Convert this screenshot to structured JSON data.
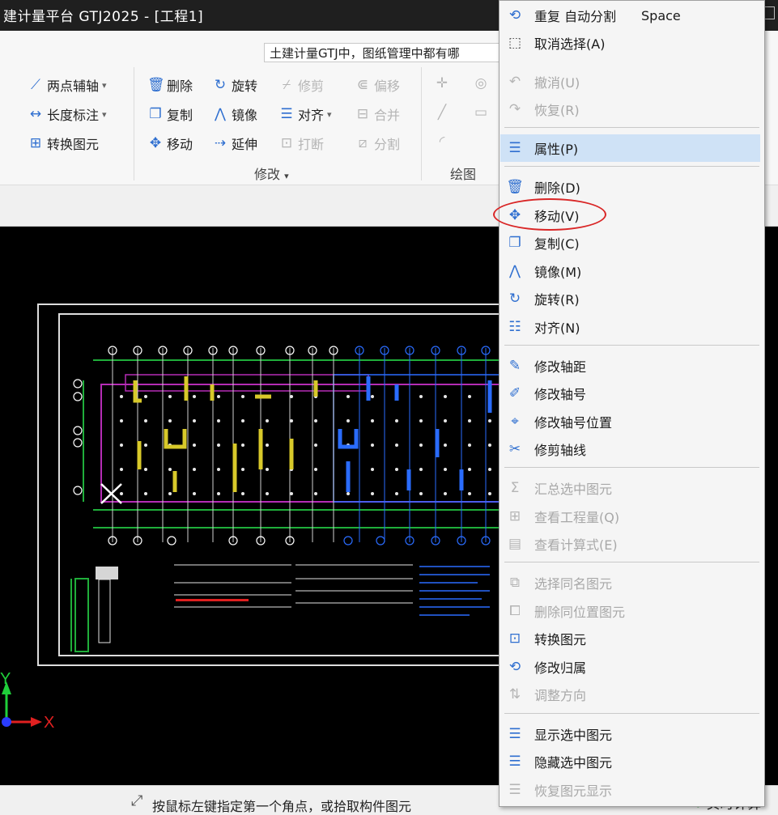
{
  "window": {
    "title": "建计量平台 GTJ2025 - [工程1]"
  },
  "search": {
    "text": "土建计量GTJ中，图纸管理中都有哪"
  },
  "ribbon": {
    "axis": {
      "two_point": "两点辅轴",
      "dim": "长度标注",
      "convert": "转换图元"
    },
    "modify": {
      "delete": "删除",
      "rotate": "旋转",
      "trim": "修剪",
      "offset": "偏移",
      "copy": "复制",
      "mirror": "镜像",
      "align": "对齐",
      "merge": "合并",
      "move": "移动",
      "extend": "延伸",
      "break": "打断",
      "split": "分割",
      "group_label": "修改"
    },
    "draw": {
      "group_label": "绘图"
    }
  },
  "context_menu": {
    "items": [
      {
        "label": "重复 自动分割",
        "shortcut": "Space",
        "icon": "repeat-icon",
        "enabled": true
      },
      {
        "label": "取消选择(A)",
        "icon": "deselect-icon",
        "enabled": true
      },
      {
        "label": "撤消(U)",
        "icon": "undo-icon",
        "enabled": false
      },
      {
        "label": "恢复(R)",
        "icon": "redo-icon",
        "enabled": false
      },
      {
        "label": "属性(P)",
        "icon": "properties-icon",
        "enabled": true,
        "highlighted": true
      },
      {
        "label": "删除(D)",
        "icon": "delete-icon",
        "enabled": true
      },
      {
        "label": "移动(V)",
        "icon": "move-icon",
        "enabled": true
      },
      {
        "label": "复制(C)",
        "icon": "copy-icon",
        "enabled": true
      },
      {
        "label": "镜像(M)",
        "icon": "mirror-icon",
        "enabled": true
      },
      {
        "label": "旋转(R)",
        "icon": "rotate-icon",
        "enabled": true
      },
      {
        "label": "对齐(N)",
        "icon": "align-icon",
        "enabled": true
      },
      {
        "label": "修改轴距",
        "icon": "edit-axis-distance-icon",
        "enabled": true
      },
      {
        "label": "修改轴号",
        "icon": "edit-axis-number-icon",
        "enabled": true
      },
      {
        "label": "修改轴号位置",
        "icon": "axis-number-position-icon",
        "enabled": true
      },
      {
        "label": "修剪轴线",
        "icon": "trim-axis-icon",
        "enabled": true
      },
      {
        "label": "汇总选中图元",
        "icon": "sum-icon",
        "enabled": false
      },
      {
        "label": "查看工程量(Q)",
        "icon": "quantity-icon",
        "enabled": false
      },
      {
        "label": "查看计算式(E)",
        "icon": "formula-icon",
        "enabled": false
      },
      {
        "label": "选择同名图元",
        "icon": "select-same-name-icon",
        "enabled": false
      },
      {
        "label": "删除同位置图元",
        "icon": "delete-same-position-icon",
        "enabled": false
      },
      {
        "label": "转换图元",
        "icon": "convert-icon",
        "enabled": true
      },
      {
        "label": "修改归属",
        "icon": "change-owner-icon",
        "enabled": true
      },
      {
        "label": "调整方向",
        "icon": "adjust-direction-icon",
        "enabled": false
      },
      {
        "label": "显示选中图元",
        "icon": "show-selected-icon",
        "enabled": true
      },
      {
        "label": "隐藏选中图元",
        "icon": "hide-selected-icon",
        "enabled": true
      },
      {
        "label": "恢复图元显示",
        "icon": "restore-display-icon",
        "enabled": false
      }
    ]
  },
  "axis_labels": {
    "x": "X",
    "y": "Y"
  },
  "status": {
    "hint": "按鼠标左键指定第一个角点，或拾取构件图元",
    "right": "实时计算"
  },
  "colors": {
    "menu_highlight": "#cfe2f6",
    "accent": "#2f6fd0",
    "annotation": "#d92626",
    "canvas": "#000000"
  }
}
